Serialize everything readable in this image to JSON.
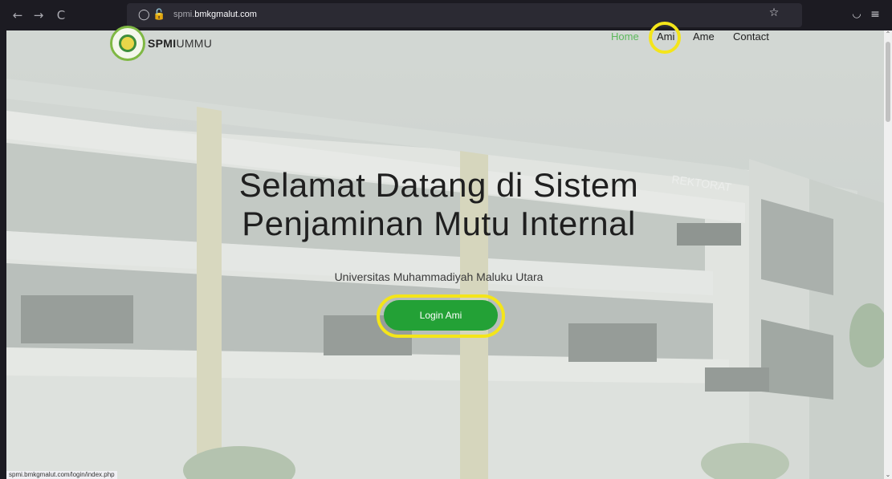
{
  "browser": {
    "back_icon": "←",
    "forward_icon": "→",
    "reload_icon": "C",
    "url_prefix": "spmi.",
    "url_domain": "bmkgmalut.com",
    "star_icon": "☆",
    "pocket_icon": "◡",
    "menu_icon": "≡",
    "status_url": "spmi.bmkgmalut.com/login/index.php"
  },
  "header": {
    "brand_bold": "SPMI",
    "brand_light": "UMMU",
    "nav": {
      "home": "Home",
      "ami": "Ami",
      "ame": "Ame",
      "contact": "Contact"
    }
  },
  "hero": {
    "title_line1": "Selamat Datang di Sistem",
    "title_line2": "Penjaminan Mutu Internal",
    "subtitle": "Universitas Muhammadiyah Maluku Utara",
    "button": "Login Ami",
    "building_sign": "REKTORAT"
  },
  "colors": {
    "accent": "#5cb85c",
    "button": "#23a136",
    "highlight": "#f4e51a"
  }
}
